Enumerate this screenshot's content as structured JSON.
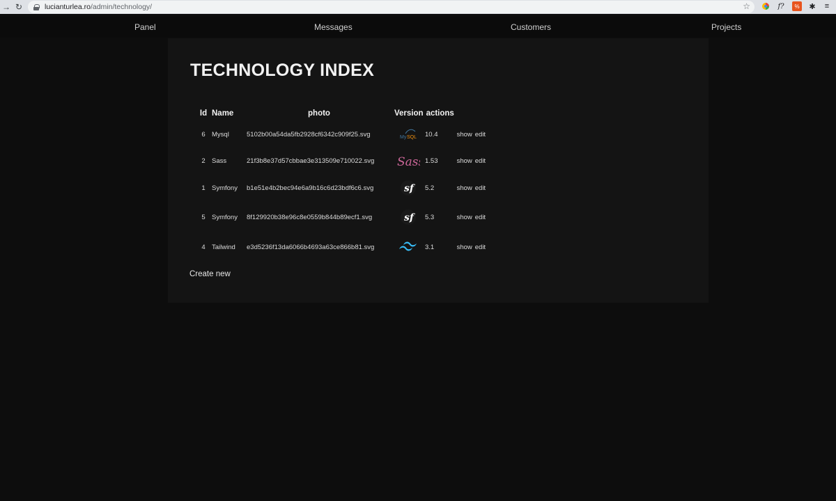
{
  "browser": {
    "url_host": "lucianturlea.ro",
    "url_path": "/admin/technology/",
    "icons": [
      "back-icon",
      "reload-icon",
      "lock-icon",
      "star-icon",
      "extension-icons"
    ]
  },
  "nav": {
    "items": [
      {
        "label": "Panel"
      },
      {
        "label": "Messages"
      },
      {
        "label": "Customers"
      },
      {
        "label": "Projects"
      }
    ]
  },
  "page": {
    "title": "TECHNOLOGY INDEX",
    "create_new": "Create new"
  },
  "table": {
    "headers": [
      "Id",
      "Name",
      "photo",
      "Version",
      "actions"
    ],
    "rows": [
      {
        "id": "6",
        "name": "Mysql",
        "photo": "5102b00a54da5fb2928cf6342c909f25.svg",
        "logo": "mysql-logo",
        "version": "10.4",
        "show": "show",
        "edit": "edit"
      },
      {
        "id": "2",
        "name": "Sass",
        "photo": "21f3b8e37d57cbbae3e313509e710022.svg",
        "logo": "sass-logo",
        "version": "1.53",
        "show": "show",
        "edit": "edit"
      },
      {
        "id": "1",
        "name": "Symfony",
        "photo": "b1e51e4b2bec94e6a9b16c6d23bdf6c6.svg",
        "logo": "symfony-logo",
        "version": "5.2",
        "show": "show",
        "edit": "edit"
      },
      {
        "id": "5",
        "name": "Symfony",
        "photo": "8f129920b38e96c8e0559b844b89ecf1.svg",
        "logo": "symfony-logo",
        "version": "5.3",
        "show": "show",
        "edit": "edit"
      },
      {
        "id": "4",
        "name": "Tailwind",
        "photo": "e3d5236f13da6066b4693a63ce866b81.svg",
        "logo": "tailwind-logo",
        "version": "3.1",
        "show": "show",
        "edit": "edit"
      }
    ]
  },
  "colors": {
    "background": "#0d0d0d",
    "panel": "#141414",
    "text": "#e6e6e6"
  }
}
